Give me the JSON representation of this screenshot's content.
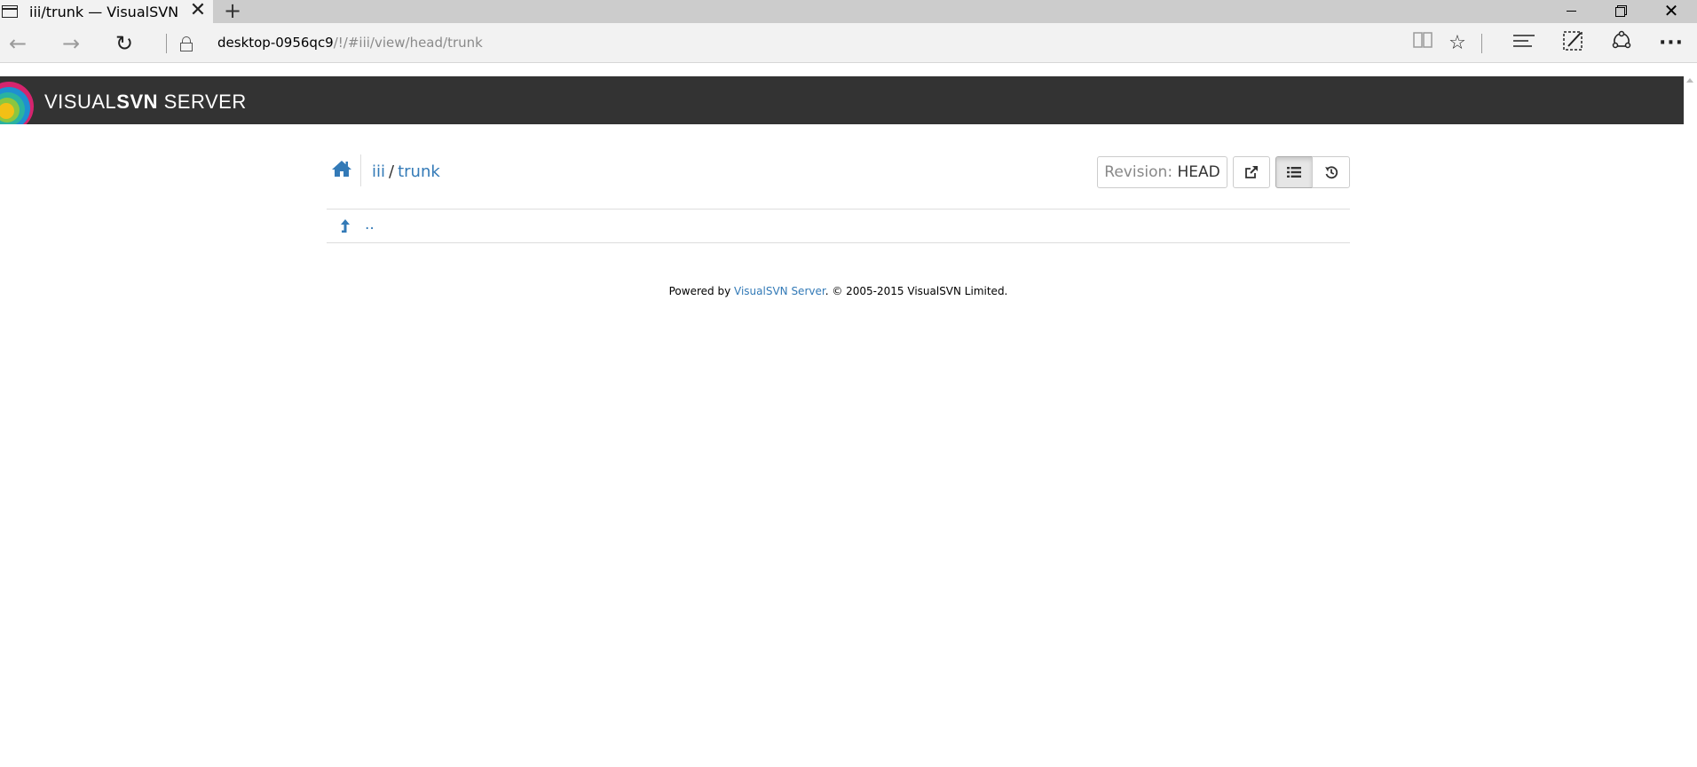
{
  "browser": {
    "tab_title": "iii/trunk — VisualSVN Se",
    "tab_close": "✕",
    "new_tab": "+",
    "url_host": "desktop-0956qc9",
    "url_path": "/!/#iii/view/head/trunk",
    "window_close": "✕"
  },
  "icons": {
    "back": "arrow-left-icon",
    "forward": "arrow-right-icon",
    "refresh": "refresh-icon",
    "lock": "lock-icon",
    "reading_view": "book-icon",
    "favorite": "star-icon",
    "hub": "hub-icon",
    "web_note": "pen-icon",
    "share": "share-icon",
    "more": "more-icon"
  },
  "header": {
    "brand_light": "VISUAL",
    "brand_bold": "SVN",
    "brand_suffix": " SERVER"
  },
  "breadcrumb": {
    "repo": "iii",
    "separator": "/",
    "folder": "trunk"
  },
  "revision": {
    "label": "Revision:",
    "value": "HEAD"
  },
  "listing": {
    "parent_link": ".."
  },
  "footer": {
    "prefix": "Powered by ",
    "link": "VisualSVN Server",
    "suffix": ". © 2005-2015 VisualSVN Limited."
  },
  "colors": {
    "header_bg": "#333333",
    "link": "#337ab7",
    "border": "#dddddd"
  }
}
